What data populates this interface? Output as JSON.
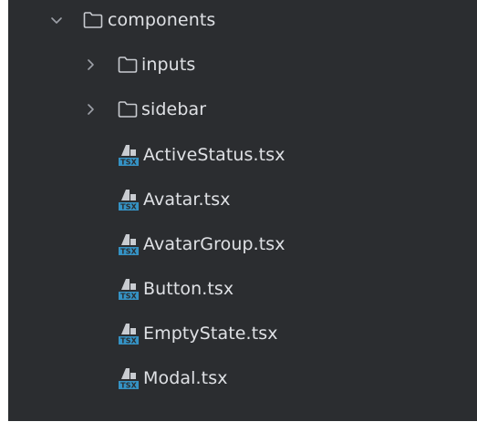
{
  "tree": {
    "root": {
      "label": "components",
      "icon": "folder-icon",
      "expanded": true
    },
    "folders": [
      {
        "label": "inputs",
        "icon": "folder-icon",
        "expanded": false
      },
      {
        "label": "sidebar",
        "icon": "folder-icon",
        "expanded": false
      }
    ],
    "files": [
      {
        "label": "ActiveStatus.tsx",
        "icon": "tsx-file-icon"
      },
      {
        "label": "Avatar.tsx",
        "icon": "tsx-file-icon"
      },
      {
        "label": "AvatarGroup.tsx",
        "icon": "tsx-file-icon"
      },
      {
        "label": "Button.tsx",
        "icon": "tsx-file-icon"
      },
      {
        "label": "EmptyState.tsx",
        "icon": "tsx-file-icon"
      },
      {
        "label": "Modal.tsx",
        "icon": "tsx-file-icon"
      }
    ]
  },
  "colors": {
    "background": "#2b2d30",
    "text": "#dfe1e5",
    "chevron": "#9da0a8",
    "tsx_badge": "#3592c4"
  }
}
